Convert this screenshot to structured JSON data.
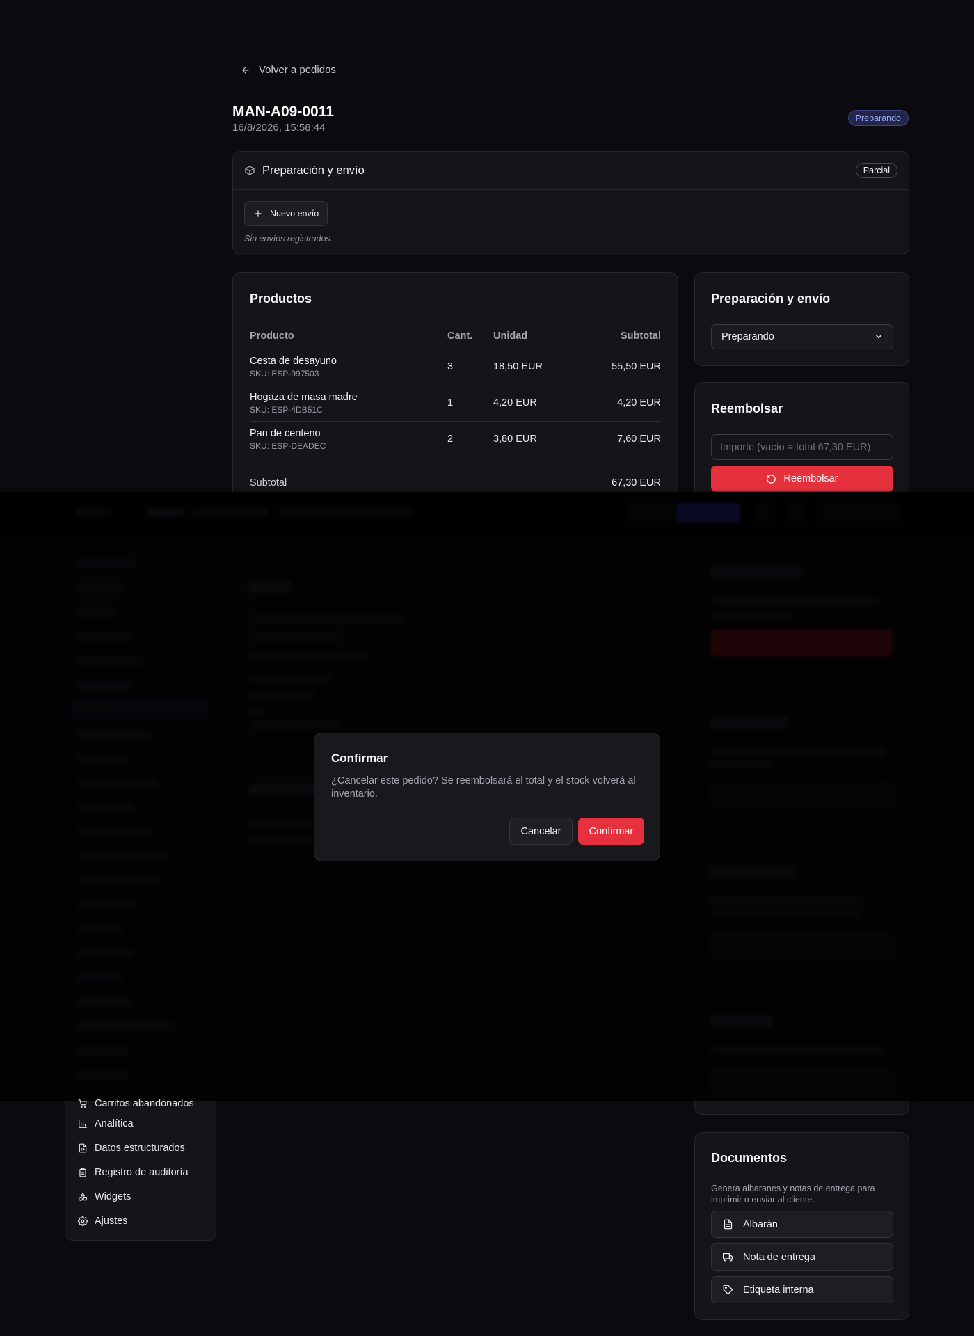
{
  "header": {
    "back_label": "Volver a pedidos",
    "order_id": "MAN-A09-0011",
    "order_date": "16/8/2026, 15:58:44",
    "status": "Preparando"
  },
  "shipping": {
    "title": "Preparación y envío",
    "badge": "Parcial",
    "new_button": "Nuevo envío",
    "empty_text": "Sin envíos registrados."
  },
  "products": {
    "title": "Productos",
    "columns": [
      "Producto",
      "Cant.",
      "Unidad",
      "Subtotal"
    ],
    "rows": [
      {
        "name": "Cesta de desayuno",
        "sku": "SKU: ESP-997503",
        "qty": "3",
        "unit": "18,50 EUR",
        "subtotal": "55,50 EUR"
      },
      {
        "name": "Hogaza de masa madre",
        "sku": "SKU: ESP-4DB51C",
        "qty": "1",
        "unit": "4,20 EUR",
        "subtotal": "4,20 EUR"
      },
      {
        "name": "Pan de centeno",
        "sku": "SKU: ESP-DEADEC",
        "qty": "2",
        "unit": "3,80 EUR",
        "subtotal": "7,60 EUR"
      }
    ],
    "subtotal_label": "Subtotal",
    "subtotal_value": "67,30 EUR"
  },
  "prep_panel": {
    "title": "Preparación y envío",
    "selected": "Preparando"
  },
  "refund": {
    "title": "Reembolsar",
    "placeholder": "Importe (vacío = total 67,30 EUR)",
    "button": "Reembolsar"
  },
  "sidebar": {
    "items": [
      {
        "label": "Carritos abandonados",
        "icon": "cart-icon"
      },
      {
        "label": "Analítica",
        "icon": "bar-chart-icon"
      },
      {
        "label": "Datos estructurados",
        "icon": "file-code-icon"
      },
      {
        "label": "Registro de auditoría",
        "icon": "clipboard-icon"
      },
      {
        "label": "Widgets",
        "icon": "shapes-icon"
      },
      {
        "label": "Ajustes",
        "icon": "gear-icon"
      }
    ]
  },
  "documents": {
    "title": "Documentos",
    "description": "Genera albaranes y notas de entrega para imprimir o enviar al cliente.",
    "buttons": [
      {
        "label": "Albarán",
        "icon": "file-text-icon"
      },
      {
        "label": "Nota de entrega",
        "icon": "truck-icon"
      },
      {
        "label": "Etiqueta interna",
        "icon": "tag-icon"
      }
    ]
  },
  "modal": {
    "title": "Confirmar",
    "body": "¿Cancelar este pedido? Se reembolsará el total y el stock volverá al inventario.",
    "cancel": "Cancelar",
    "confirm": "Confirmar"
  },
  "colors": {
    "accent": "#e5303e",
    "status_badge": "#9fa8ff",
    "background": "#0b0b0f"
  }
}
